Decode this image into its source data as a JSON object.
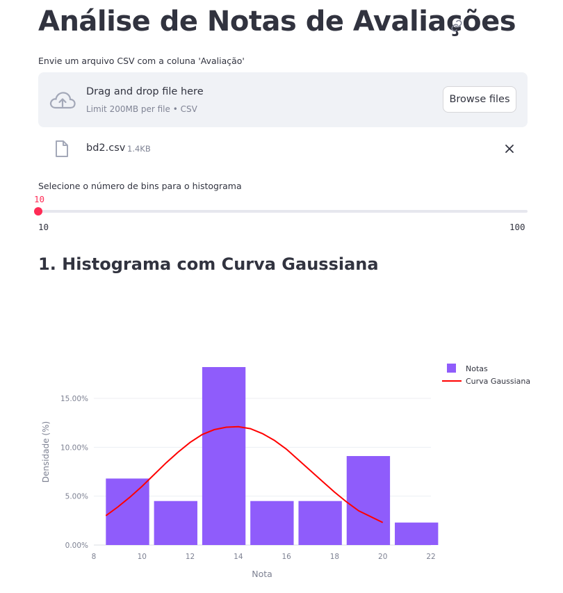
{
  "page": {
    "title": "Análise de Notas de Avaliações"
  },
  "upload": {
    "label": "Envie um arquivo CSV com a coluna 'Avaliação'",
    "drop_title": "Drag and drop file here",
    "drop_subtitle": "Limit 200MB per file • CSV",
    "browse_label": "Browse files",
    "file_name": "bd2.csv",
    "file_size": "1.4KB"
  },
  "slider": {
    "label": "Selecione o número de bins para o histograma",
    "value": "10",
    "min": "10",
    "max": "100",
    "fraction": 0
  },
  "section": {
    "title": "1. Histograma com Curva Gaussiana"
  },
  "icons": {
    "title_link": "link-icon",
    "upload": "cloud-upload-icon",
    "file": "file-icon",
    "remove": "close-icon"
  },
  "colors": {
    "accent": "#ff2b55",
    "bar": "#8f5cfb",
    "curve": "#ff0000",
    "text": "#31333f",
    "muted": "#808495",
    "dropzone_bg": "#f0f2f6"
  },
  "chart_data": {
    "type": "bar",
    "xlabel": "Nota",
    "ylabel": "Densidade (%)",
    "xlim": [
      8,
      22
    ],
    "ylim": [
      0,
      18.2
    ],
    "xticks": [
      8,
      10,
      12,
      14,
      16,
      18,
      20,
      22
    ],
    "yticks": [
      0,
      5,
      10,
      15
    ],
    "ytick_labels": [
      "0.00%",
      "5.00%",
      "10.00%",
      "15.00%"
    ],
    "grid": true,
    "legend_position": "top-right",
    "series": [
      {
        "name": "Notas",
        "kind": "histogram",
        "bins": [
          {
            "x0": 8.5,
            "x1": 10.3,
            "value": 6.8
          },
          {
            "x0": 10.5,
            "x1": 12.3,
            "value": 4.5
          },
          {
            "x0": 12.5,
            "x1": 14.3,
            "value": 18.2
          },
          {
            "x0": 14.5,
            "x1": 16.3,
            "value": 4.5
          },
          {
            "x0": 16.5,
            "x1": 18.3,
            "value": 4.5
          },
          {
            "x0": 18.5,
            "x1": 20.3,
            "value": 9.1
          },
          {
            "x0": 20.5,
            "x1": 22.3,
            "value": 2.3
          }
        ]
      },
      {
        "name": "Curva Gaussiana",
        "kind": "line",
        "x": [
          8.5,
          9,
          9.5,
          10,
          10.5,
          11,
          11.5,
          12,
          12.5,
          13,
          13.5,
          14,
          14.5,
          15,
          15.5,
          16,
          16.5,
          17,
          17.5,
          18,
          18.5,
          19,
          19.5,
          20
        ],
        "y": [
          3.0,
          3.9,
          4.9,
          6.0,
          7.2,
          8.4,
          9.5,
          10.5,
          11.3,
          11.8,
          12.05,
          12.1,
          11.9,
          11.4,
          10.7,
          9.8,
          8.7,
          7.6,
          6.5,
          5.4,
          4.4,
          3.5,
          2.9,
          2.3
        ]
      }
    ]
  }
}
